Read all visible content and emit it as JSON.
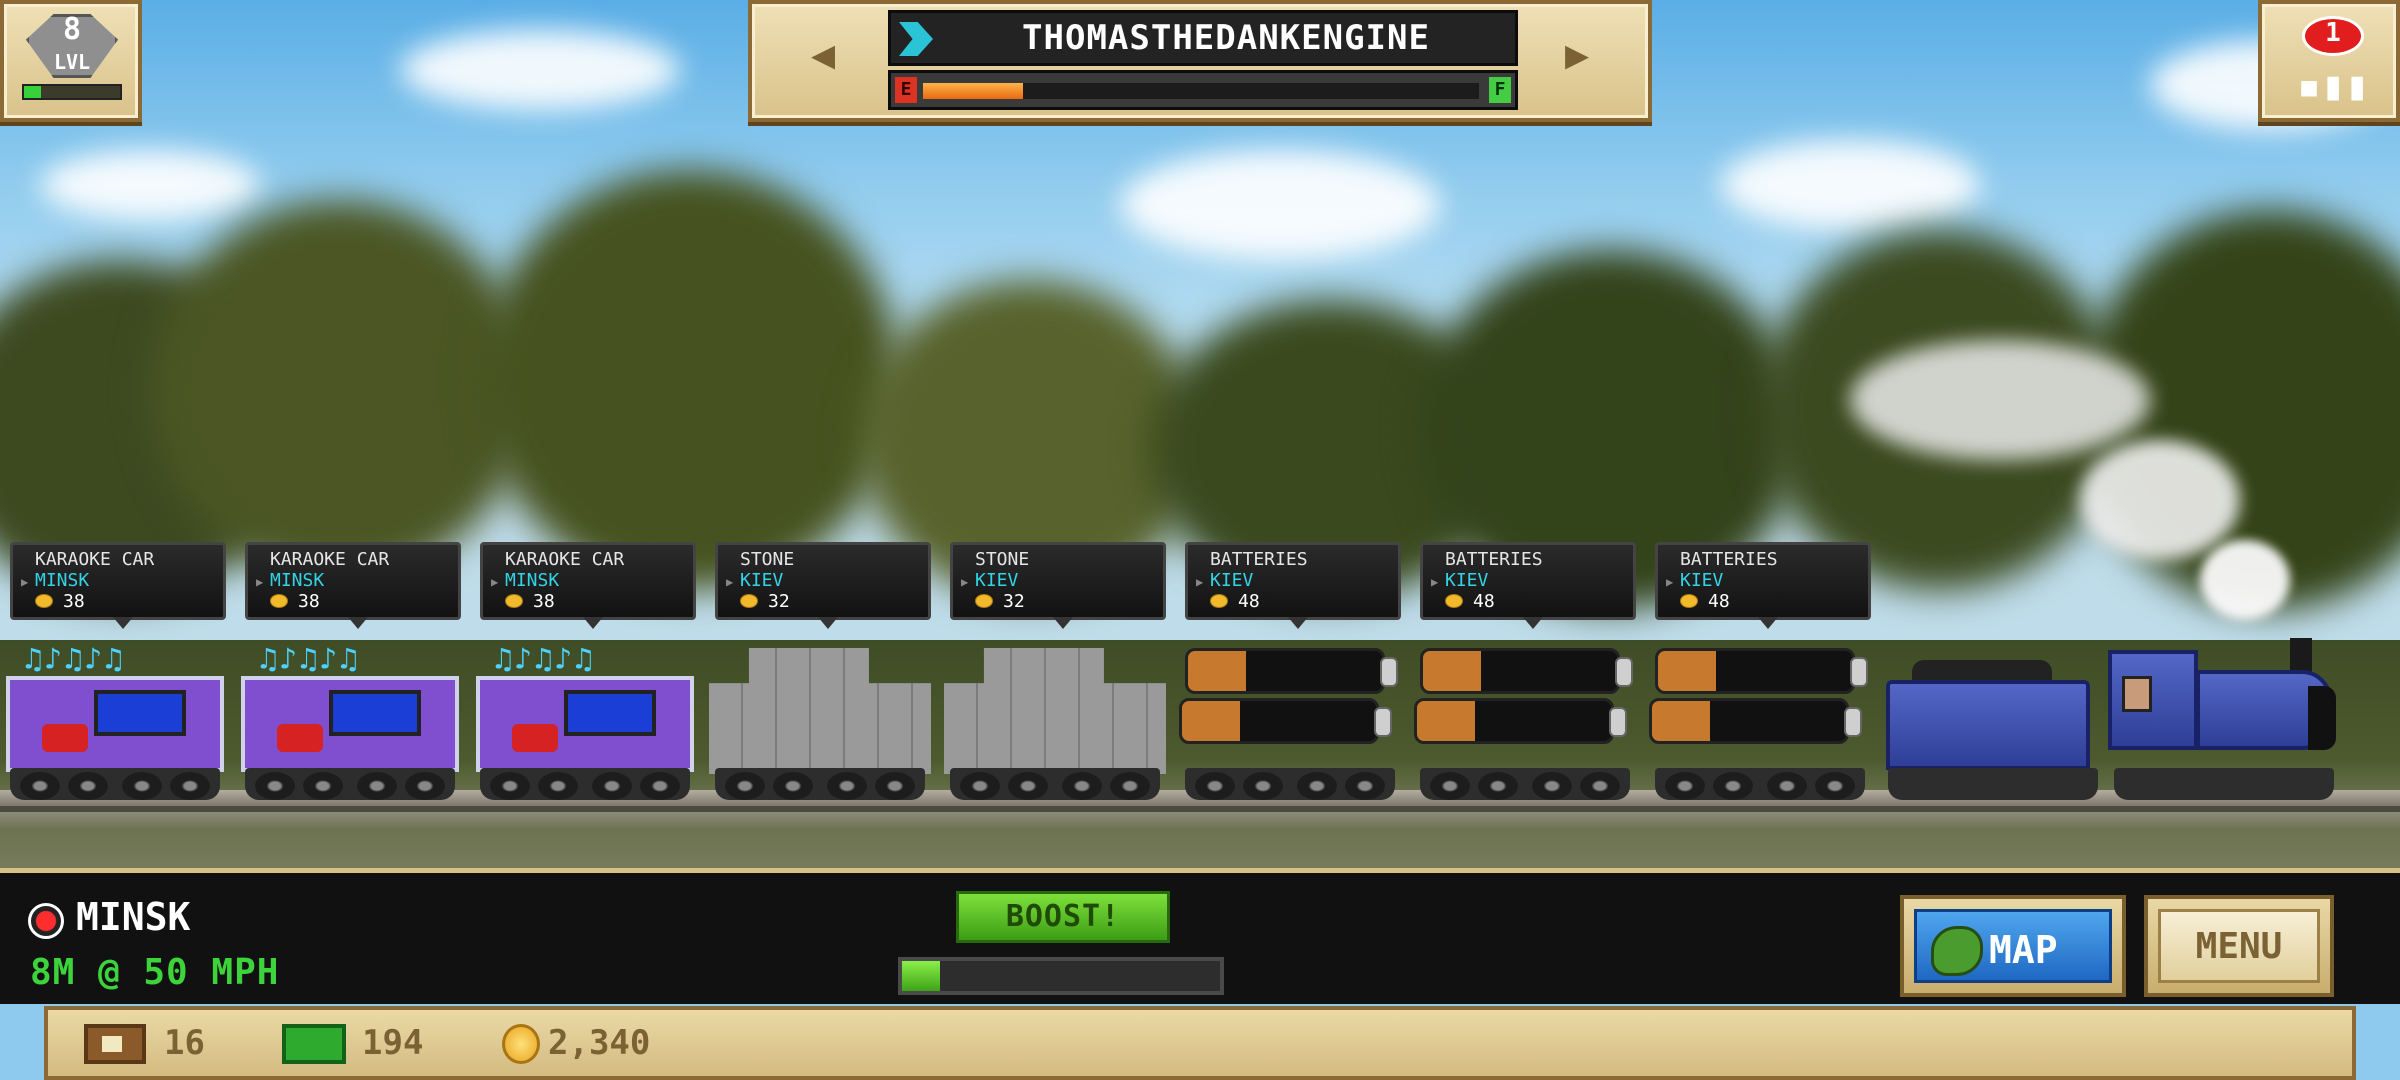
{
  "hud": {
    "level": {
      "number": "8",
      "label": "LVL",
      "progress": 0.18
    },
    "notifications": {
      "count": "1",
      "icon": "train-icon"
    },
    "train": {
      "name": "THOMASTHEDANKENGINE",
      "fuel_empty_label": "E",
      "fuel_full_label": "F",
      "fuel_level": 0.18
    }
  },
  "cars": [
    {
      "name": "KARAOKE CAR",
      "destination": "MINSK",
      "coins": "38",
      "type": "karaoke"
    },
    {
      "name": "KARAOKE CAR",
      "destination": "MINSK",
      "coins": "38",
      "type": "karaoke"
    },
    {
      "name": "KARAOKE CAR",
      "destination": "MINSK",
      "coins": "38",
      "type": "karaoke"
    },
    {
      "name": "STONE",
      "destination": "KIEV",
      "coins": "32",
      "type": "stone"
    },
    {
      "name": "STONE",
      "destination": "KIEV",
      "coins": "32",
      "type": "stone"
    },
    {
      "name": "BATTERIES",
      "destination": "KIEV",
      "coins": "48",
      "type": "batteries"
    },
    {
      "name": "BATTERIES",
      "destination": "KIEV",
      "coins": "48",
      "type": "batteries"
    },
    {
      "name": "BATTERIES",
      "destination": "KIEV",
      "coins": "48",
      "type": "batteries"
    }
  ],
  "status": {
    "station": "MINSK",
    "speed_text": "8M @ 50 MPH",
    "boost_label": "BOOST!",
    "boost_progress": 0.12
  },
  "buttons": {
    "map_label": "MAP",
    "menu_label": "MENU"
  },
  "resources": {
    "crates": "16",
    "cash": "194",
    "coins": "2,340"
  },
  "colors": {
    "destination_text": "#31d4e6",
    "speed_text": "#3cd43a",
    "boost_button": "#5fbf2a",
    "fuel_fill": "#f08a20",
    "locomotive": "#3e52b4"
  }
}
